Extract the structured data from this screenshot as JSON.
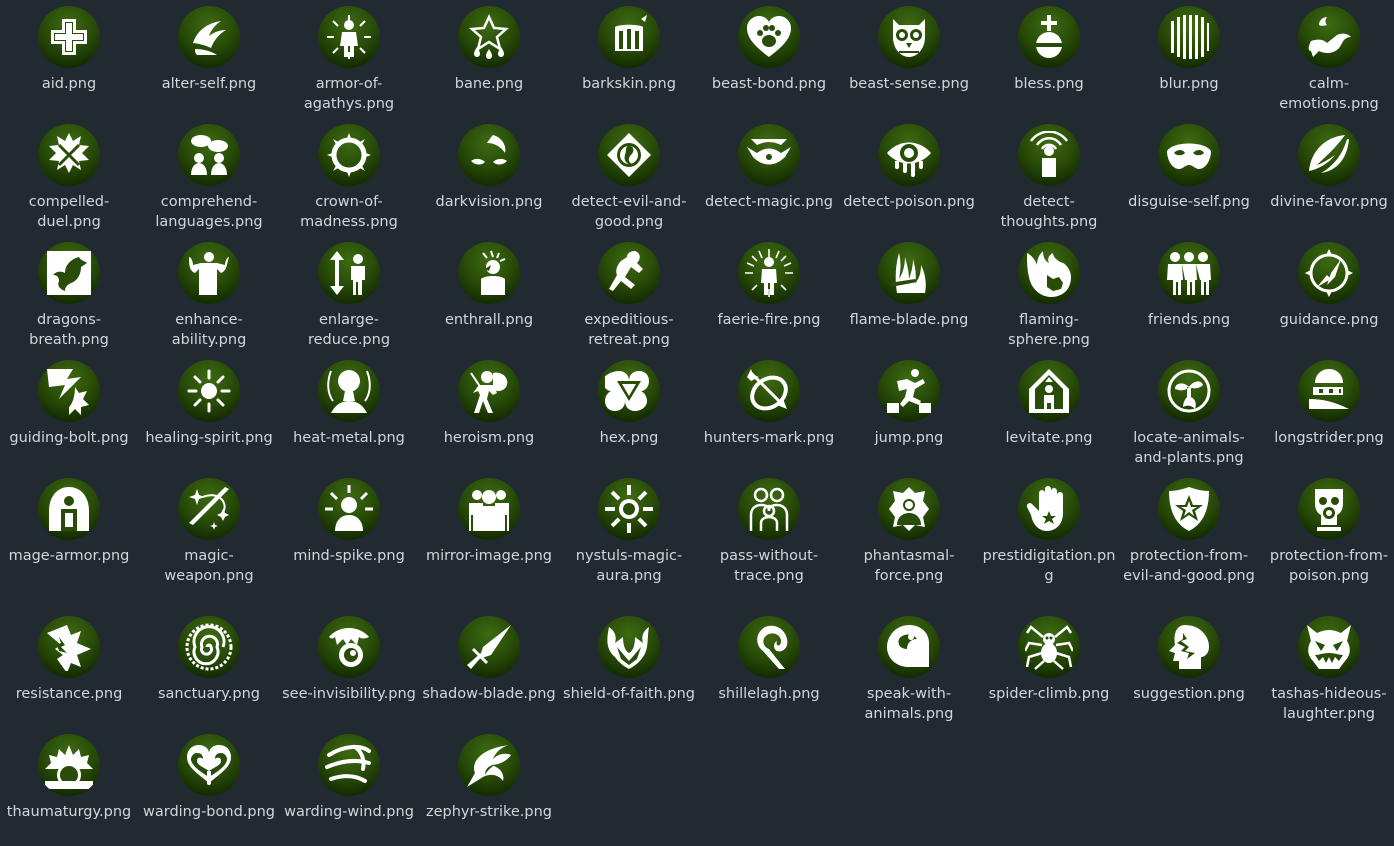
{
  "colors": {
    "background": "#222a31",
    "icon_dark": "#0b1b00",
    "icon_mid": "#294d08",
    "icon_light": "#3d6a12",
    "label_text": "#d2d6d9"
  },
  "files": [
    {
      "name": "aid.png",
      "icon": "aid-icon"
    },
    {
      "name": "alter-self.png",
      "icon": "alter-self-icon"
    },
    {
      "name": "armor-of-agathys.png",
      "icon": "armor-of-agathys-icon"
    },
    {
      "name": "bane.png",
      "icon": "bane-icon"
    },
    {
      "name": "barkskin.png",
      "icon": "barkskin-icon"
    },
    {
      "name": "beast-bond.png",
      "icon": "beast-bond-icon"
    },
    {
      "name": "beast-sense.png",
      "icon": "beast-sense-icon"
    },
    {
      "name": "bless.png",
      "icon": "bless-icon"
    },
    {
      "name": "blur.png",
      "icon": "blur-icon"
    },
    {
      "name": "calm-emotions.png",
      "icon": "calm-emotions-icon"
    },
    {
      "name": "compelled-duel.png",
      "icon": "compelled-duel-icon"
    },
    {
      "name": "comprehend-languages.png",
      "icon": "comprehend-languages-icon"
    },
    {
      "name": "crown-of-madness.png",
      "icon": "crown-of-madness-icon"
    },
    {
      "name": "darkvision.png",
      "icon": "darkvision-icon"
    },
    {
      "name": "detect-evil-and-good.png",
      "icon": "detect-evil-and-good-icon"
    },
    {
      "name": "detect-magic.png",
      "icon": "detect-magic-icon"
    },
    {
      "name": "detect-poison.png",
      "icon": "detect-poison-icon"
    },
    {
      "name": "detect-thoughts.png",
      "icon": "detect-thoughts-icon"
    },
    {
      "name": "disguise-self.png",
      "icon": "disguise-self-icon"
    },
    {
      "name": "divine-favor.png",
      "icon": "divine-favor-icon"
    },
    {
      "name": "dragons-breath.png",
      "icon": "dragons-breath-icon"
    },
    {
      "name": "enhance-ability.png",
      "icon": "enhance-ability-icon"
    },
    {
      "name": "enlarge-reduce.png",
      "icon": "enlarge-reduce-icon"
    },
    {
      "name": "enthrall.png",
      "icon": "enthrall-icon"
    },
    {
      "name": "expeditious-retreat.png",
      "icon": "expeditious-retreat-icon"
    },
    {
      "name": "faerie-fire.png",
      "icon": "faerie-fire-icon"
    },
    {
      "name": "flame-blade.png",
      "icon": "flame-blade-icon"
    },
    {
      "name": "flaming-sphere.png",
      "icon": "flaming-sphere-icon"
    },
    {
      "name": "friends.png",
      "icon": "friends-icon"
    },
    {
      "name": "guidance.png",
      "icon": "guidance-icon"
    },
    {
      "name": "guiding-bolt.png",
      "icon": "guiding-bolt-icon"
    },
    {
      "name": "healing-spirit.png",
      "icon": "healing-spirit-icon"
    },
    {
      "name": "heat-metal.png",
      "icon": "heat-metal-icon"
    },
    {
      "name": "heroism.png",
      "icon": "heroism-icon"
    },
    {
      "name": "hex.png",
      "icon": "hex-icon"
    },
    {
      "name": "hunters-mark.png",
      "icon": "hunters-mark-icon"
    },
    {
      "name": "jump.png",
      "icon": "jump-icon"
    },
    {
      "name": "levitate.png",
      "icon": "levitate-icon"
    },
    {
      "name": "locate-animals-and-plants.png",
      "icon": "locate-animals-and-plants-icon"
    },
    {
      "name": "longstrider.png",
      "icon": "longstrider-icon"
    },
    {
      "name": "mage-armor.png",
      "icon": "mage-armor-icon"
    },
    {
      "name": "magic-weapon.png",
      "icon": "magic-weapon-icon"
    },
    {
      "name": "mind-spike.png",
      "icon": "mind-spike-icon"
    },
    {
      "name": "mirror-image.png",
      "icon": "mirror-image-icon"
    },
    {
      "name": "nystuls-magic-aura.png",
      "icon": "nystuls-magic-aura-icon"
    },
    {
      "name": "pass-without-trace.png",
      "icon": "pass-without-trace-icon"
    },
    {
      "name": "phantasmal-force.png",
      "icon": "phantasmal-force-icon"
    },
    {
      "name": "prestidigitation.png",
      "icon": "prestidigitation-icon"
    },
    {
      "name": "protection-from-evil-and-good.png",
      "icon": "protection-from-evil-and-good-icon"
    },
    {
      "name": "protection-from-poison.png",
      "icon": "protection-from-poison-icon"
    },
    {
      "name": "resistance.png",
      "icon": "resistance-icon"
    },
    {
      "name": "sanctuary.png",
      "icon": "sanctuary-icon"
    },
    {
      "name": "see-invisibility.png",
      "icon": "see-invisibility-icon"
    },
    {
      "name": "shadow-blade.png",
      "icon": "shadow-blade-icon"
    },
    {
      "name": "shield-of-faith.png",
      "icon": "shield-of-faith-icon"
    },
    {
      "name": "shillelagh.png",
      "icon": "shillelagh-icon"
    },
    {
      "name": "speak-with-animals.png",
      "icon": "speak-with-animals-icon"
    },
    {
      "name": "spider-climb.png",
      "icon": "spider-climb-icon"
    },
    {
      "name": "suggestion.png",
      "icon": "suggestion-icon"
    },
    {
      "name": "tashas-hideous-laughter.png",
      "icon": "tashas-hideous-laughter-icon"
    },
    {
      "name": "thaumaturgy.png",
      "icon": "thaumaturgy-icon"
    },
    {
      "name": "warding-bond.png",
      "icon": "warding-bond-icon"
    },
    {
      "name": "warding-wind.png",
      "icon": "warding-wind-icon"
    },
    {
      "name": "zephyr-strike.png",
      "icon": "zephyr-strike-icon"
    }
  ]
}
